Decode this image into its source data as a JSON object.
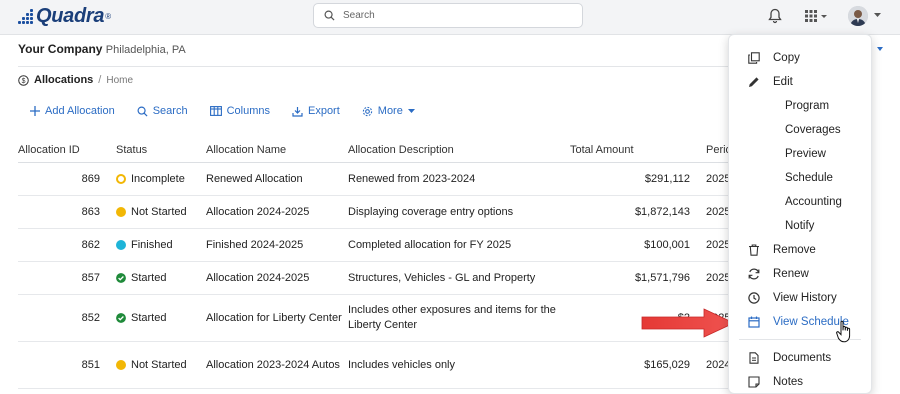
{
  "app": {
    "brand": "Quadra",
    "brand_mark": "®",
    "search_placeholder": "Search"
  },
  "company": {
    "name": "Your Company",
    "location": "Philadelphia, PA"
  },
  "breadcrumb": {
    "current": "Allocations",
    "separator": "/",
    "home": "Home"
  },
  "toolbar": {
    "add": "Add Allocation",
    "search": "Search",
    "columns": "Columns",
    "export": "Export",
    "more": "More"
  },
  "table": {
    "headers": {
      "id": "Allocation ID",
      "status": "Status",
      "name": "Allocation Name",
      "desc": "Allocation Description",
      "amount": "Total Amount",
      "period": "Perio"
    },
    "rows": [
      {
        "id": "869",
        "status": "Incomplete",
        "name": "Renewed Allocation",
        "desc": "Renewed from 2023-2024",
        "amount": "$291,112",
        "period": "2025"
      },
      {
        "id": "863",
        "status": "Not Started",
        "name": "Allocation 2024-2025",
        "desc": "Displaying coverage entry options",
        "amount": "$1,872,143",
        "period": "2025"
      },
      {
        "id": "862",
        "status": "Finished",
        "name": "Finished 2024-2025",
        "desc": "Completed allocation for FY 2025",
        "amount": "$100,001",
        "period": "2025"
      },
      {
        "id": "857",
        "status": "Started",
        "name": "Allocation 2024-2025",
        "desc": "Structures, Vehicles - GL and Property",
        "amount": "$1,571,796",
        "period": "2025"
      },
      {
        "id": "852",
        "status": "Started",
        "name": "Allocation for Liberty Center",
        "desc": "Includes other exposures and items for the Liberty Center",
        "amount": "$2",
        "period": "2025"
      },
      {
        "id": "851",
        "status": "Not Started",
        "name": "Allocation 2023-2024 Autos",
        "desc": "Includes vehicles only",
        "amount": "$165,029",
        "period": "2024"
      }
    ]
  },
  "menu": {
    "copy": "Copy",
    "edit": "Edit",
    "program": "Program",
    "coverages": "Coverages",
    "preview": "Preview",
    "schedule": "Schedule",
    "accounting": "Accounting",
    "notify": "Notify",
    "remove": "Remove",
    "renew": "Renew",
    "view_history": "View History",
    "view_schedule": "View Schedule",
    "documents": "Documents",
    "notes": "Notes"
  },
  "colors": {
    "accent": "#2b6cc4",
    "incomplete": "#f2b705",
    "not_started": "#f2b705",
    "finished": "#1eb4d8",
    "started": "#1f8a3a",
    "arrow": "#e53935"
  }
}
